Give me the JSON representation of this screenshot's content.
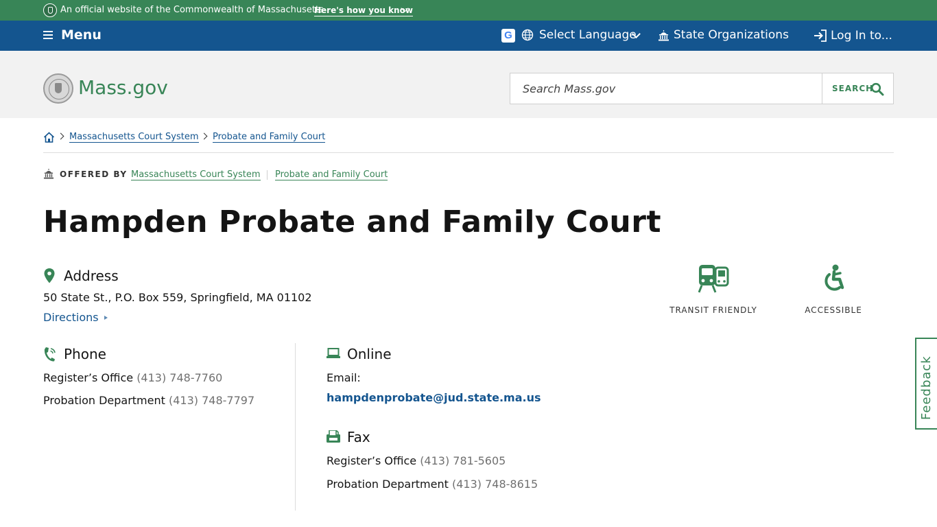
{
  "official_bar": {
    "text": "An official website of the Commonwealth of Massachusetts",
    "how_link": "Here's how you know"
  },
  "nav": {
    "menu_label": "Menu",
    "google_letter": "G",
    "language_label": "Select Language",
    "organizations_label": "State Organizations",
    "login_label": "Log In to..."
  },
  "header": {
    "wordmark": "Mass.gov",
    "search_placeholder": "Search Mass.gov",
    "search_button_label": "SEARCH"
  },
  "breadcrumb": {
    "items": [
      "Massachusetts Court System",
      "Probate and Family Court"
    ]
  },
  "offered_by": {
    "label": "OFFERED BY",
    "orgs": [
      "Massachusetts Court System",
      "Probate and Family Court"
    ]
  },
  "page": {
    "title": "Hampden Probate and Family Court"
  },
  "address": {
    "heading": "Address",
    "line": "50 State St., P.O. Box 559, Springfield, MA 01102",
    "directions_label": "Directions"
  },
  "phone": {
    "heading": "Phone",
    "entries": [
      {
        "label": "Register’s Office",
        "number": "(413) 748-7760"
      },
      {
        "label": "Probation Department",
        "number": "(413) 748-7797"
      }
    ]
  },
  "online": {
    "heading": "Online",
    "email_label": "Email:",
    "email": "hampdenprobate@jud.state.ma.us"
  },
  "fax": {
    "heading": "Fax",
    "entries": [
      {
        "label": "Register’s Office",
        "number": "(413) 781-5605"
      },
      {
        "label": "Probation Department",
        "number": "(413) 748-8615"
      }
    ]
  },
  "amenities": [
    {
      "label": "TRANSIT FRIENDLY",
      "icon": "transit-icon"
    },
    {
      "label": "ACCESSIBLE",
      "icon": "accessible-icon"
    }
  ],
  "feedback": {
    "label": "Feedback"
  },
  "colors": {
    "brand_green": "#388557",
    "brand_blue": "#14558f",
    "header_gray": "#f2f2f2"
  }
}
